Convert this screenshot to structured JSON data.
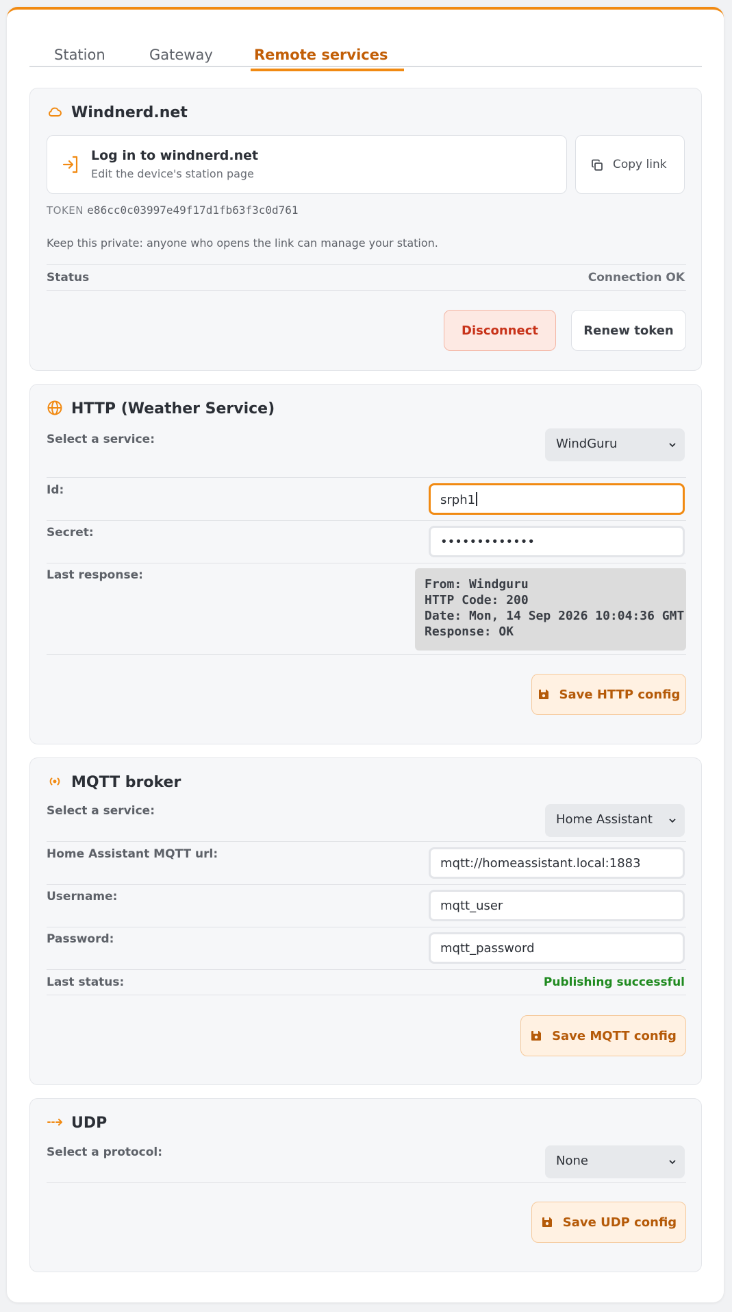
{
  "tabs": [
    {
      "label": "Station"
    },
    {
      "label": "Gateway"
    },
    {
      "label": "Remote services",
      "active": true
    }
  ],
  "windnerd": {
    "title": "Windnerd.net",
    "login_title": "Log in to windnerd.net",
    "login_subtitle": "Edit the device's station page",
    "copy_label": "Copy link",
    "token_label": "TOKEN",
    "token_value": "e86cc0c03997e49f17d1fb63f3c0d761",
    "warning": "Keep this private: anyone who opens the link can manage your station.",
    "status_label": "Status",
    "status_value": "Connection OK",
    "disconnect_label": "Disconnect",
    "renew_label": "Renew token"
  },
  "http": {
    "title": "HTTP (Weather Service)",
    "service_label": "Select a service:",
    "service_value": "WindGuru",
    "id_label": "Id:",
    "id_value": "srph1",
    "secret_label": "Secret:",
    "secret_value": "•••••••••••••",
    "last_response_label": "Last response:",
    "last_response_lines": [
      "From: Windguru",
      "HTTP Code: 200",
      "Date: Mon, 14 Sep 2026 10:04:36 GMT",
      "Response: OK"
    ],
    "save_label": "Save HTTP config"
  },
  "mqtt": {
    "title": "MQTT broker",
    "service_label": "Select a service:",
    "service_value": "Home Assistant",
    "url_label": "Home Assistant MQTT url:",
    "url_value": "mqtt://homeassistant.local:1883",
    "username_label": "Username:",
    "username_value": "mqtt_user",
    "password_label": "Password:",
    "password_value": "mqtt_password",
    "last_status_label": "Last status:",
    "last_status_value": "Publishing successful",
    "save_label": "Save MQTT config"
  },
  "udp": {
    "title": "UDP",
    "protocol_label": "Select a protocol:",
    "protocol_value": "None",
    "save_label": "Save UDP config"
  },
  "colors": {
    "accent": "#f18a12",
    "accent_text": "#c25e06",
    "danger": "#c8331a",
    "success": "#1f8a1f"
  },
  "icons": {
    "windnerd": "cloud-icon",
    "login": "login-icon",
    "copy": "copy-icon",
    "http": "globe-icon",
    "mqtt": "broadcast-icon",
    "udp": "arrow-right-icon",
    "save": "floppy-disk-icon",
    "select": "chevron-down-icon"
  }
}
